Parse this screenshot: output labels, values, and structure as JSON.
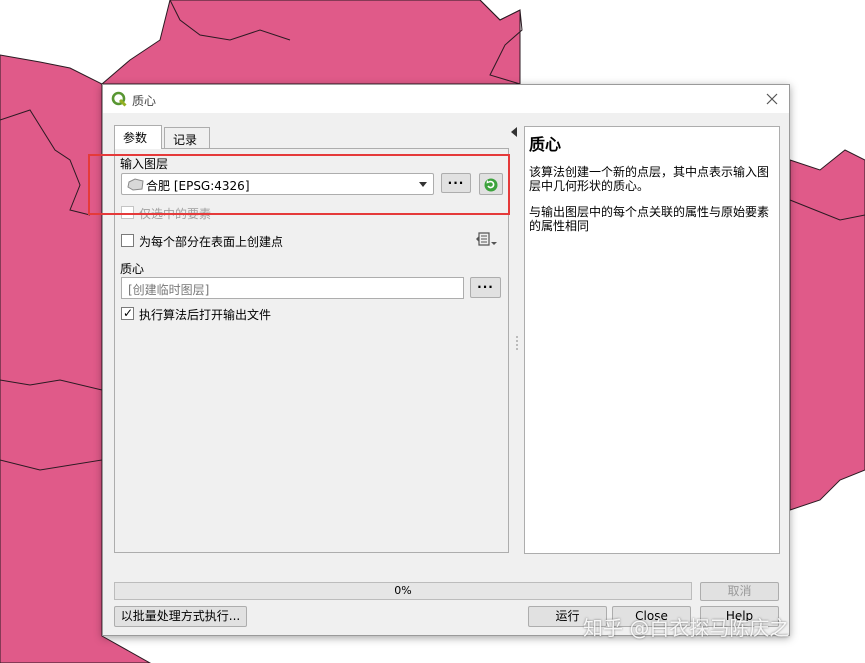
{
  "window": {
    "title": "质心",
    "app_icon": "qgis-q-icon",
    "close_icon": "close-icon"
  },
  "tabs": [
    {
      "label": "参数",
      "active": true
    },
    {
      "label": "记录",
      "active": false
    }
  ],
  "params": {
    "input_layer_label": "输入图层",
    "input_layer_value": "合肥 [EPSG:4326]",
    "selected_only_label": "仅选中的要素",
    "selected_only_checked": false,
    "each_part_label": "为每个部分在表面上创建点",
    "each_part_checked": false,
    "centroids_label": "质心",
    "centroids_placeholder": "[创建临时图层]",
    "open_after_label": "执行算法后打开输出文件",
    "open_after_checked": true,
    "check_glyph": "✓",
    "dots": "···"
  },
  "help": {
    "title": "质心",
    "p1": "该算法创建一个新的点层，其中点表示输入图层中几何形状的质心。",
    "p2": "与输出图层中的每个点关联的属性与原始要素的属性相同"
  },
  "progress": {
    "value": 0,
    "text": "0%"
  },
  "buttons": {
    "cancel": "取消",
    "batch": "以批量处理方式执行...",
    "run": "运行",
    "close": "Close",
    "help": "Help"
  },
  "watermark": "知乎 @白衣探马陈庆之",
  "colors": {
    "map_fill": "#e05a89",
    "map_border": "#2b1a22",
    "annotation": "#e53a3a"
  }
}
